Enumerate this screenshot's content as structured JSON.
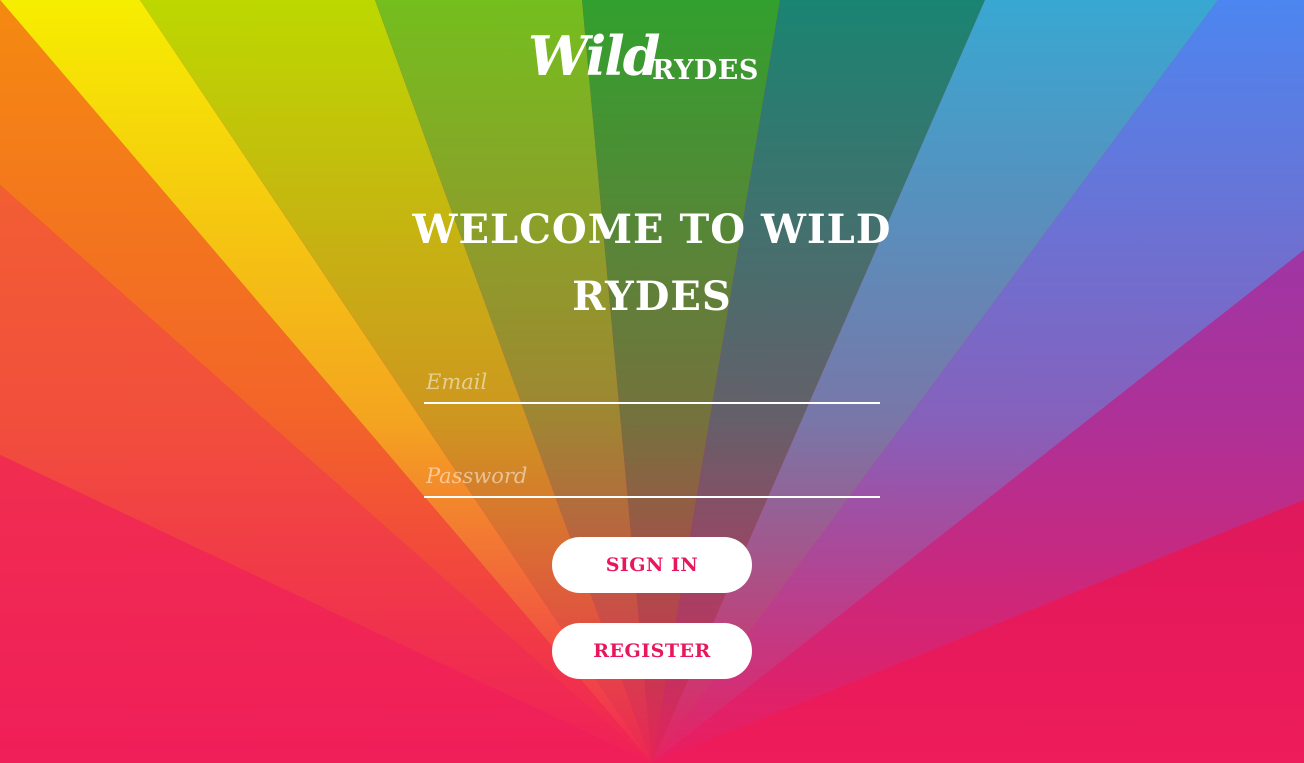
{
  "colors": {
    "accent": "#e8175d",
    "text": "#ffffff",
    "bottom": "#f01c5a"
  },
  "logo": {
    "wild": "Wild",
    "rydes": "RYDES"
  },
  "page": {
    "title": "WELCOME TO WILD RYDES"
  },
  "form": {
    "email_placeholder": "Email",
    "password_placeholder": "Password",
    "signin_label": "SIGN IN",
    "register_label": "REGISTER"
  }
}
